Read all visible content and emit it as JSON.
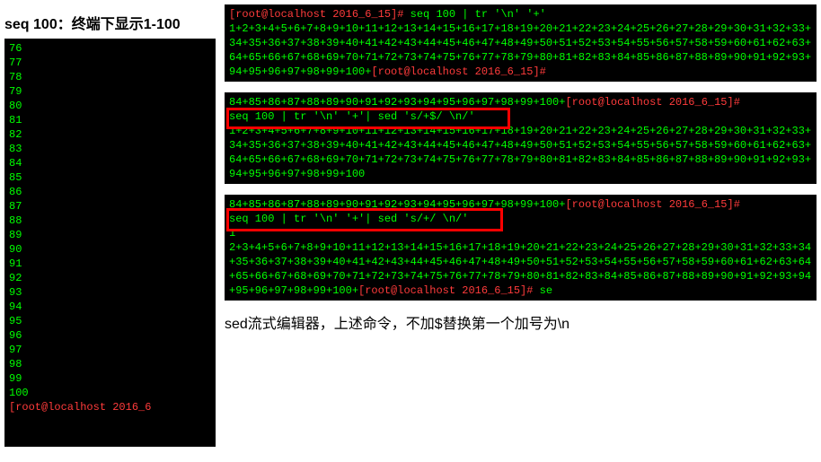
{
  "left": {
    "caption": "seq 100：终端下显示1-100",
    "numbers": "76\n77\n78\n79\n80\n81\n82\n83\n84\n85\n86\n87\n88\n89\n90\n91\n92\n93\n94\n95\n96\n97\n98\n99\n100",
    "prompt_partial": "[root@localhost 2016_6"
  },
  "term1": {
    "prompt": "[root@localhost 2016_6_15]# ",
    "cmd": "seq 100 | tr '\\n' '+'",
    "out": "1+2+3+4+5+6+7+8+9+10+11+12+13+14+15+16+17+18+19+20+21+22+23+24+25+26+27+28+29+30+31+32+33+34+35+36+37+38+39+40+41+42+43+44+45+46+47+48+49+50+51+52+53+54+55+56+57+58+59+60+61+62+63+64+65+66+67+68+69+70+71+72+73+74+75+76+77+78+79+80+81+82+83+84+85+86+87+88+89+90+91+92+93+94+95+96+97+98+99+100+",
    "prompt2": "[root@localhost 2016_6_15]#"
  },
  "term2": {
    "pre": "84+85+86+87+88+89+90+91+92+93+94+95+96+97+98+99+100+",
    "pre_prompt": "[root@localhost 2016_6_15]#",
    "cmd": "seq 100 | tr '\\n' '+'| sed 's/+$/ \\n/'",
    "out": "1+2+3+4+5+6+7+8+9+10+11+12+13+14+15+16+17+18+19+20+21+22+23+24+25+26+27+28+29+30+31+32+33+34+35+36+37+38+39+40+41+42+43+44+45+46+47+48+49+50+51+52+53+54+55+56+57+58+59+60+61+62+63+64+65+66+67+68+69+70+71+72+73+74+75+76+77+78+79+80+81+82+83+84+85+86+87+88+89+90+91+92+93+94+95+96+97+98+99+100"
  },
  "term3": {
    "pre": "84+85+86+87+88+89+90+91+92+93+94+95+96+97+98+99+100+",
    "pre_prompt": "[root@localhost 2016_6_15]#",
    "cmd": "seq 100 | tr '\\n' '+'| sed 's/+/ \\n/'",
    "outl1": "1",
    "out": "2+3+4+5+6+7+8+9+10+11+12+13+14+15+16+17+18+19+20+21+22+23+24+25+26+27+28+29+30+31+32+33+34+35+36+37+38+39+40+41+42+43+44+45+46+47+48+49+50+51+52+53+54+55+56+57+58+59+60+61+62+63+64+65+66+67+68+69+70+71+72+73+74+75+76+77+78+79+80+81+82+83+84+85+86+87+88+89+90+91+92+93+94+95+96+97+98+99+100+",
    "prompt2": "[root@localhost 2016_6_15]# ",
    "tail": "se"
  },
  "note": "sed流式编辑器，上述命令，不加$替换第一个加号为\\n"
}
